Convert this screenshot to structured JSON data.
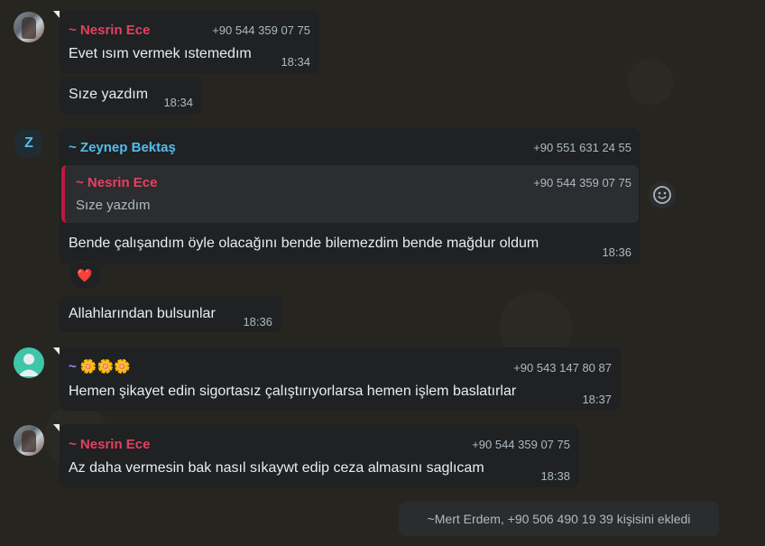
{
  "colors": {
    "background": "#27251f",
    "bubble": "#1f2123",
    "sender_red": "#e6405f",
    "sender_blue": "#53bdeb",
    "sender_purple": "#a78bfa",
    "quote_bar": "#c0183c"
  },
  "messages": [
    {
      "sender": "~ Nesrin Ece",
      "phone": "+90 544 359 07 75",
      "text": "Evet ısım vermek ıstemedım",
      "time": "18:34"
    },
    {
      "text": "Sıze yazdım",
      "time": "18:34"
    },
    {
      "avatar_letter": "Z",
      "sender": "~ Zeynep Bektaş",
      "phone": "+90 551 631 24 55",
      "quote": {
        "sender": "~ Nesrin Ece",
        "phone": "+90 544 359 07 75",
        "text": "Sıze yazdım"
      },
      "text": "Bende çalışandım öyle olacağını bende bilemezdim bende mağdur oldum",
      "time": "18:36",
      "reaction": "❤️"
    },
    {
      "text": "Allahlarından bulsunlar",
      "time": "18:36"
    },
    {
      "sender": "~ 🌼🌼🌼",
      "phone": "+90 543 147 80 87",
      "text": "Hemen şikayet edin sigortasız çalıştırıyorlarsa hemen işlem baslatırlar",
      "time": "18:37"
    },
    {
      "sender": "~ Nesrin Ece",
      "phone": "+90 544 359 07 75",
      "text": "Az daha vermesin bak nasıl sıkaywt edip ceza almasını saglıcam",
      "time": "18:38"
    }
  ],
  "system_message": "~Mert Erdem, +90 506 490 19 39 kişisini ekledi"
}
